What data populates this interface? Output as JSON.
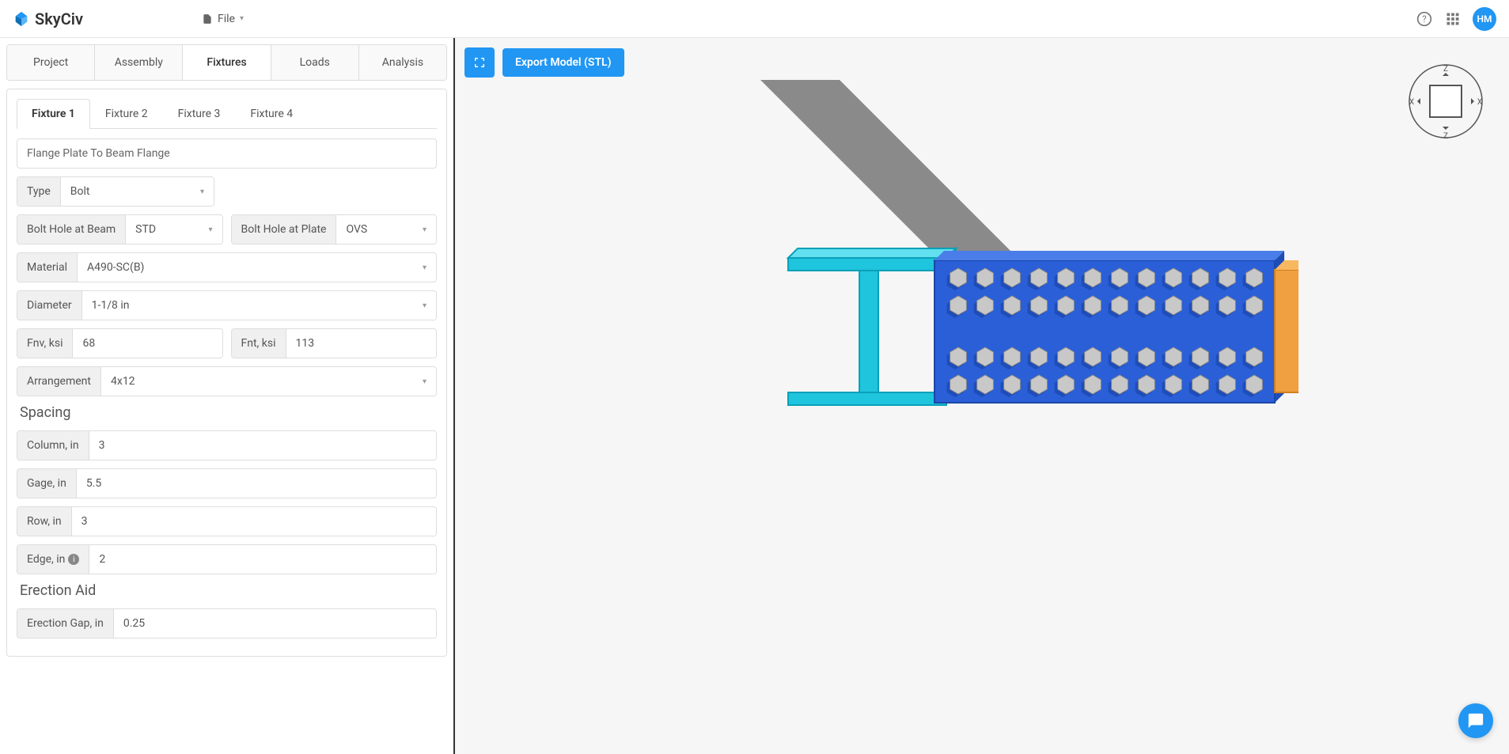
{
  "topbar": {
    "brand": "SkyCiv",
    "file_label": "File",
    "avatar_initials": "HM"
  },
  "main_tabs": [
    "Project",
    "Assembly",
    "Fixtures",
    "Loads",
    "Analysis"
  ],
  "main_tab_active": "Fixtures",
  "fixture_tabs": [
    "Fixture 1",
    "Fixture 2",
    "Fixture 3",
    "Fixture 4"
  ],
  "fixture_tab_active": "Fixture 1",
  "fixture": {
    "name": "Flange Plate To Beam Flange",
    "type_label": "Type",
    "type_value": "Bolt",
    "bolt_hole_beam_label": "Bolt Hole at Beam",
    "bolt_hole_beam_value": "STD",
    "bolt_hole_plate_label": "Bolt Hole at Plate",
    "bolt_hole_plate_value": "OVS",
    "material_label": "Material",
    "material_value": "A490-SC(B)",
    "diameter_label": "Diameter",
    "diameter_value": "1-1/8 in",
    "fnv_label": "Fnv, ksi",
    "fnv_value": "68",
    "fnt_label": "Fnt, ksi",
    "fnt_value": "113",
    "arrangement_label": "Arrangement",
    "arrangement_value": "4x12"
  },
  "spacing": {
    "header": "Spacing",
    "column_label": "Column, in",
    "column_value": "3",
    "gage_label": "Gage, in",
    "gage_value": "5.5",
    "row_label": "Row, in",
    "row_value": "3",
    "edge_label": "Edge, in",
    "edge_value": "2"
  },
  "erection": {
    "header": "Erection Aid",
    "gap_label": "Erection Gap, in",
    "gap_value": "0.25"
  },
  "canvas": {
    "export_label": "Export Model (STL)",
    "axes": {
      "up": "Z",
      "down": "Z",
      "left": "X",
      "right": "X"
    }
  }
}
